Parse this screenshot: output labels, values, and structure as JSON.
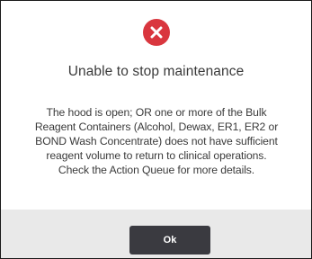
{
  "dialog": {
    "icon": "error-x-circle-icon",
    "title": "Unable to stop maintenance",
    "message_lines": [
      "The hood is open; OR one or more of the Bulk",
      "Reagent Containers (Alcohol, Dewax, ER1, ER2 or",
      "BOND Wash Concentrate) does not have sufficient",
      "reagent volume to return to clinical operations.",
      "Check the Action Queue for more details."
    ],
    "ok_label": "Ok"
  },
  "colors": {
    "error_icon": "#d9363e",
    "button_bg": "#3a3a40",
    "footer_bg": "#e9e9e9",
    "text": "#3a3a3a"
  }
}
